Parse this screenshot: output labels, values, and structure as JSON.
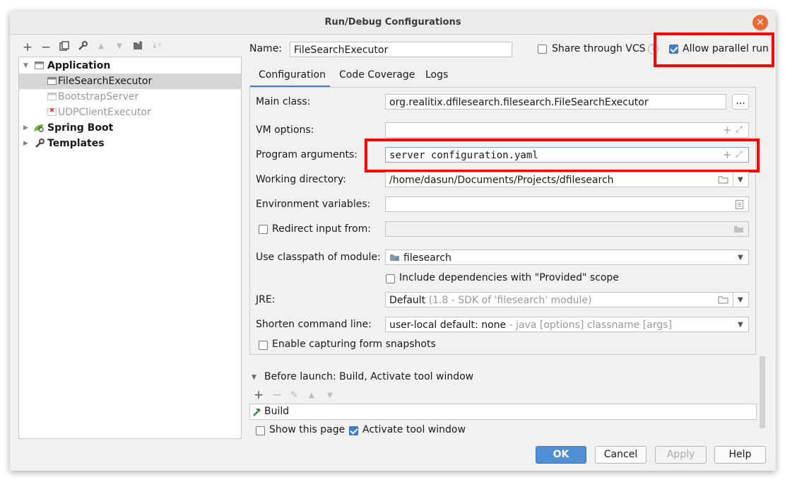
{
  "window": {
    "title": "Run/Debug Configurations",
    "close_label": "✕"
  },
  "tree": {
    "application": "Application",
    "items": [
      "FileSearchExecutor",
      "BootstrapServer",
      "UDPClientExecutor"
    ],
    "spring_boot": "Spring Boot",
    "templates": "Templates"
  },
  "header": {
    "name_label": "Name:",
    "name_value": "FileSearchExecutor",
    "share_vcs": "Share through VCS",
    "allow_parallel": "Allow parallel run"
  },
  "tabs": [
    "Configuration",
    "Code Coverage",
    "Logs"
  ],
  "config": {
    "main_class_label": "Main class:",
    "main_class_value": "org.realitix.dfilesearch.filesearch.FileSearchExecutor",
    "browse_label": "...",
    "vm_options_label": "VM options:",
    "vm_options_value": "",
    "program_args_label": "Program arguments:",
    "program_args_value": "server configuration.yaml",
    "working_dir_label": "Working directory:",
    "working_dir_value": "/home/dasun/Documents/Projects/dfilesearch",
    "env_vars_label": "Environment variables:",
    "env_vars_value": "",
    "redirect_label": "Redirect input from:",
    "classpath_label": "Use classpath of module:",
    "classpath_value": "filesearch",
    "include_deps_label": "Include dependencies with \"Provided\" scope",
    "jre_label": "JRE:",
    "jre_value": "Default",
    "jre_hint": "(1.8 - SDK of 'filesearch' module)",
    "shorten_label": "Shorten command line:",
    "shorten_value": "user-local default: none",
    "shorten_hint": "- java [options] classname [args]",
    "capture_label": "Enable capturing form snapshots"
  },
  "before_launch": {
    "title": "Before launch: Build, Activate tool window",
    "build_item": "Build",
    "show_page": "Show this page",
    "activate_tool": "Activate tool window"
  },
  "buttons": {
    "ok": "OK",
    "cancel": "Cancel",
    "apply": "Apply",
    "help": "Help"
  },
  "colors": {
    "accent": "#3f7fce",
    "highlight": "#ff0000",
    "close": "#ef6a33"
  }
}
